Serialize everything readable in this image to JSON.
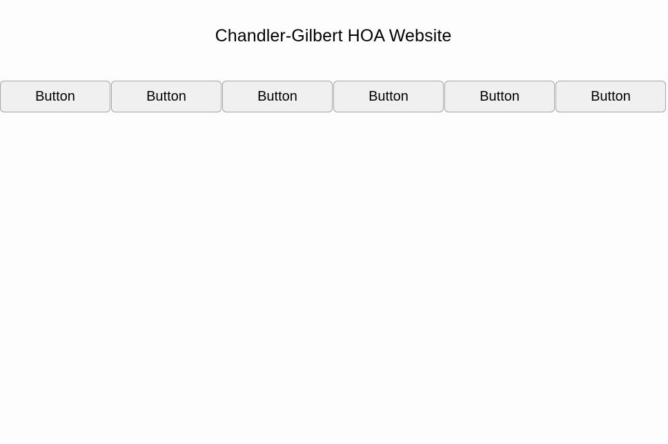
{
  "header": {
    "title": "Chandler-Gilbert HOA Website"
  },
  "nav": {
    "buttons": [
      {
        "label": "Button"
      },
      {
        "label": "Button"
      },
      {
        "label": "Button"
      },
      {
        "label": "Button"
      },
      {
        "label": "Button"
      },
      {
        "label": "Button"
      }
    ]
  },
  "colors": {
    "background": "#fdfdfd",
    "button_fill": "#f0f0f0",
    "button_border": "#a3a3a3",
    "text": "#000000"
  }
}
